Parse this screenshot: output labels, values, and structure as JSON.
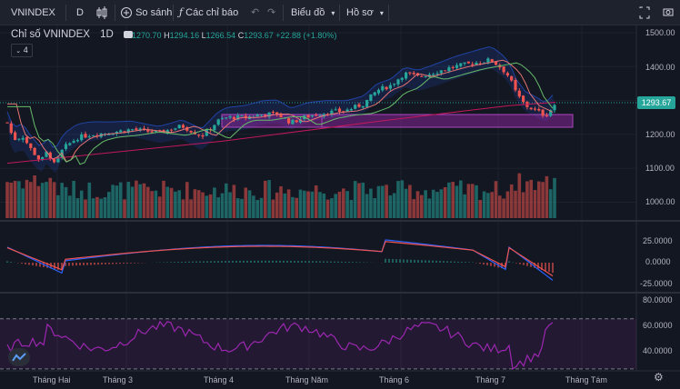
{
  "toolbar": {
    "symbol": "VNINDEX",
    "interval": "D",
    "chart_style_icon": "candles-icon",
    "compare_label": "So sánh",
    "indicators_label": "Các chỉ báo",
    "chart_label": "Biểu đồ",
    "profile_label": "Hồ sơ"
  },
  "legend": {
    "title": "Chỉ số VNINDEX",
    "interval": "1D",
    "open_label": "O",
    "open": "1270.70",
    "high_label": "H",
    "high": "1294.16",
    "low_label": "L",
    "low": "1266.54",
    "close_label": "C",
    "close": "1293.67",
    "change": "+22.88 (+1.80%)",
    "indicator_count": "4"
  },
  "price_tag": "1293.67",
  "price_axis": [
    "1500.00",
    "1400.00",
    "1300.00",
    "1200.00",
    "1100.00",
    "1000.00"
  ],
  "macd_axis": [
    "25.0000",
    "0.0000",
    "-25.0000"
  ],
  "rsi_axis": [
    "80.0000",
    "60.0000",
    "40.0000"
  ],
  "time_axis": [
    "Tháng Hai",
    "Tháng 3",
    "Tháng 4",
    "Tháng Năm",
    "Tháng 6",
    "Tháng 7",
    "Tháng Tám"
  ],
  "colors": {
    "bg": "#131722",
    "up": "#26a69a",
    "down": "#ef5350",
    "ma": "#c2185b",
    "band": "#2962ff",
    "rsi": "#9c27b0"
  }
}
